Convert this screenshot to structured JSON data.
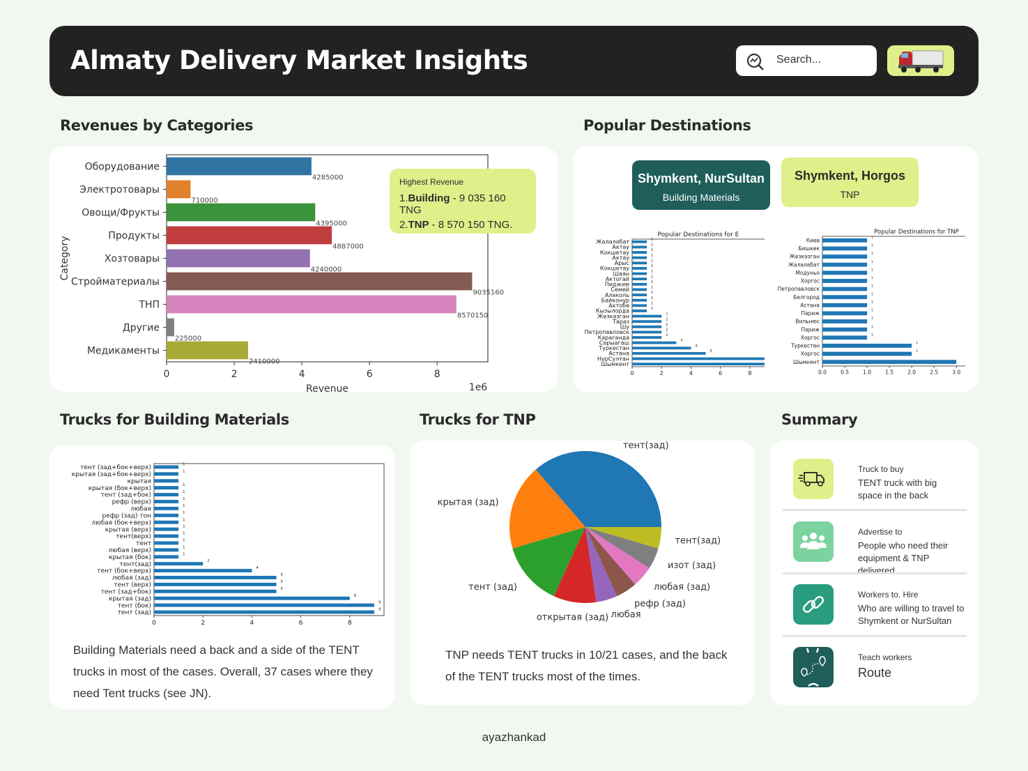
{
  "header": {
    "title": "Almaty Delivery Market Insights",
    "search_placeholder": "Search..."
  },
  "sections": {
    "revenues": "Revenues by Categories",
    "destinations": "Popular Destinations",
    "trucks_building": "Trucks for Building Materials",
    "trucks_tnp": "Trucks for TNP",
    "summary": "Summary"
  },
  "highlight": {
    "title": "Highest Revenue",
    "items": [
      {
        "num": "1.",
        "name": "Building",
        "value": " - 9 035 160 TNG"
      },
      {
        "num": "2.",
        "name": "TNP",
        "value": " - 8 570 150 TNG."
      }
    ]
  },
  "destinations": {
    "boxes": [
      {
        "route": "Shymkent, NurSultan",
        "category": "Building Materials"
      },
      {
        "route": "Shymkent, Horgos",
        "category": "TNP"
      }
    ]
  },
  "texts": {
    "building": "Building Materials need a back and a side of the TENT trucks in most of the cases. Overall, 37 cases where they need Tent trucks (see JN).",
    "tnp": "TNP needs TENT trucks in 10/21 cases, and the back of the TENT trucks most of the times."
  },
  "summary": [
    {
      "title": "Truck to buy",
      "lines": [
        "TENT truck with big",
        "space in the back"
      ],
      "icon": "truck-icon",
      "color": "#dff08a"
    },
    {
      "title": "Advertise to",
      "lines": [
        "People who need their",
        "equipment  & TNP delivered."
      ],
      "icon": "people-icon",
      "color": "#7dd3a0"
    },
    {
      "title": "Workers to. Hire",
      "lines": [
        "Who are willing to travel to",
        "Shymkent or NurSultan"
      ],
      "icon": "link-icon",
      "color": "#2a9d7f"
    },
    {
      "title": "Teach workers",
      "lines": [
        "Route"
      ],
      "icon": "route-icon",
      "color": "#1f5e5a"
    }
  ],
  "footer": "ayazhankad",
  "chart_data": [
    {
      "id": "revenue",
      "type": "bar",
      "orientation": "horizontal",
      "categories": [
        "Оборудование",
        "Электротовары",
        "Овощи/Фрукты",
        "Продукты",
        "Хозтовары",
        "Стройматериалы",
        "ТНП",
        "Другие",
        "Медикаменты"
      ],
      "values": [
        4285000,
        710000,
        4395000,
        4887000,
        4240000,
        9035160,
        8570150,
        225000,
        2410000
      ],
      "labels": [
        "4285000",
        "710000",
        "4395000",
        "4887000",
        "4240000",
        "9035160",
        "8570150",
        "225000",
        "2410000"
      ],
      "colors": [
        "#3274a1",
        "#e1812c",
        "#3a923a",
        "#c03d3e",
        "#9372b2",
        "#845b53",
        "#d684bd",
        "#7f7f7f",
        "#a9aa35"
      ],
      "xlabel": "Revenue",
      "ylabel": "Category",
      "xlim": [
        0,
        9500000
      ],
      "xticks": [
        "0",
        "2",
        "4",
        "6",
        "8"
      ],
      "xscale_label": "1e6"
    },
    {
      "id": "dest_building",
      "type": "bar",
      "orientation": "horizontal",
      "title": "Popular Destinations for E",
      "categories": [
        "Жалалабат",
        "Актау",
        "Кокшетау",
        "Актау",
        "Арыс",
        "Кокшетау",
        "Шаян",
        "Актогай",
        "Пиджим",
        "Семей",
        "Алаколь",
        "Байконур",
        "Актобе",
        "Кызылорда",
        "Жезказган",
        "Тараз",
        "Шу",
        "Петропавловск",
        "Караганда",
        "Сарыагаш",
        "Туркестан",
        "Астана",
        "НурСултан",
        "Шымкент"
      ],
      "values": [
        1,
        1,
        1,
        1,
        1,
        1,
        1,
        1,
        1,
        1,
        1,
        1,
        1,
        1,
        2,
        2,
        2,
        2,
        2,
        3,
        4,
        5,
        9,
        9
      ],
      "labels": [
        "1",
        "1",
        "1",
        "1",
        "1",
        "1",
        "1",
        "1",
        "1",
        "1",
        "1",
        "1",
        "1",
        "1",
        "2",
        "2",
        "2",
        "2",
        "2",
        "3",
        "4",
        "5",
        "",
        ""
      ],
      "xlim": [
        0,
        9
      ],
      "xticks": [
        "0",
        "2",
        "4",
        "6",
        "8"
      ]
    },
    {
      "id": "dest_tnp",
      "type": "bar",
      "orientation": "horizontal",
      "title": "Popular Destinations for TNP",
      "categories": [
        "Киев",
        "Бишкек",
        "Жезказган",
        "Жалалабат",
        "Модуньо",
        "Хоргос",
        "Петропавловск",
        "Белгород",
        "Астана",
        "Париж",
        "Вильнюс",
        "Париж",
        "Хоргос",
        "Туркестан",
        "Хоргос",
        "Шымкент"
      ],
      "values": [
        1,
        1,
        1,
        1,
        1,
        1,
        1,
        1,
        1,
        1,
        1,
        1,
        1,
        2,
        2,
        3
      ],
      "labels": [
        "1",
        "1",
        "1",
        "1",
        "1",
        "1",
        "1",
        "1",
        "1",
        "1",
        "1",
        "1",
        "1",
        "2",
        "2",
        ""
      ],
      "xlim": [
        0,
        3.2
      ],
      "xticks": [
        "0.0",
        "0.5",
        "1.0",
        "1.5",
        "2.0",
        "2.5",
        "3.0"
      ]
    },
    {
      "id": "trucks_building",
      "type": "bar",
      "orientation": "horizontal",
      "categories": [
        "тент (зад+бок+верх)",
        "крытая (зад+бок+верх)",
        "крытая",
        "крытая (бок+верх)",
        "тент (зад+бок)",
        "рефр (верх)",
        "любая",
        "рефр (зад) тон",
        "любая (бок+верх)",
        "крытая (верх)",
        "тент(верх)",
        "тент",
        "любая (верх)",
        "крытая (бок)",
        "тент(зад)",
        "тент (бок+верх)",
        "любая (зад)",
        "тент (верх)",
        "тент (зад+бок)",
        "крытая (зад)",
        "тент (бок)",
        "тент (зад)"
      ],
      "values": [
        1,
        1,
        1,
        1,
        1,
        1,
        1,
        1,
        1,
        1,
        1,
        1,
        1,
        1,
        2,
        4,
        5,
        5,
        5,
        8,
        9,
        9
      ],
      "labels": [
        "1",
        "1",
        "",
        "1",
        "1",
        "1",
        "1",
        "1",
        "1",
        "1",
        "1",
        "1",
        "1",
        "1",
        "2",
        "4",
        "5",
        "5",
        "5",
        "8",
        "9",
        "9"
      ],
      "xlim": [
        0,
        9.4
      ],
      "xticks": [
        "0",
        "2",
        "4",
        "6",
        "8"
      ]
    },
    {
      "id": "trucks_tnp",
      "type": "pie",
      "categories": [
        "тент(зад)",
        "крытая (зад)",
        "тент (зад)",
        "открытая (зад)",
        "любая",
        "рефр (зад)",
        "любая (зад)",
        "изот (зад)",
        "тент(зад)"
      ],
      "values": [
        8,
        4,
        3,
        2,
        1,
        1,
        1,
        1,
        1
      ],
      "colors": [
        "#1f77b4",
        "#ff7f0e",
        "#2ca02c",
        "#d62728",
        "#9467bd",
        "#8c564b",
        "#e377c2",
        "#7f7f7f",
        "#bcbd22"
      ]
    }
  ]
}
